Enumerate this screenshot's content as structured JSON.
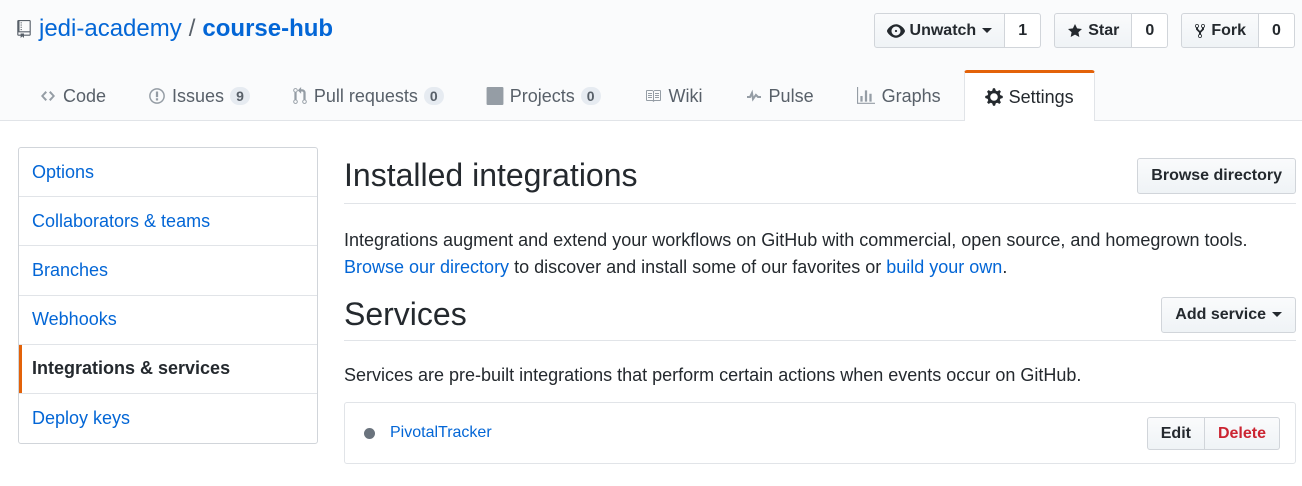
{
  "repo": {
    "owner": "jedi-academy",
    "separator": "/",
    "name": "course-hub"
  },
  "actions": [
    {
      "label": "Unwatch",
      "icon": "eye-icon",
      "count": "1",
      "dropdown": true
    },
    {
      "label": "Star",
      "icon": "star-icon",
      "count": "0"
    },
    {
      "label": "Fork",
      "icon": "fork-icon",
      "count": "0"
    }
  ],
  "tabs": [
    {
      "label": "Code",
      "icon": "code-icon"
    },
    {
      "label": "Issues",
      "icon": "issue-icon",
      "counter": "9"
    },
    {
      "label": "Pull requests",
      "icon": "pull-request-icon",
      "counter": "0"
    },
    {
      "label": "Projects",
      "icon": "project-icon",
      "counter": "0"
    },
    {
      "label": "Wiki",
      "icon": "book-icon"
    },
    {
      "label": "Pulse",
      "icon": "pulse-icon"
    },
    {
      "label": "Graphs",
      "icon": "graph-icon"
    },
    {
      "label": "Settings",
      "icon": "gear-icon",
      "selected": true
    }
  ],
  "sidebar": {
    "items": [
      {
        "label": "Options"
      },
      {
        "label": "Collaborators & teams"
      },
      {
        "label": "Branches"
      },
      {
        "label": "Webhooks"
      },
      {
        "label": "Integrations & services",
        "selected": true
      },
      {
        "label": "Deploy keys"
      }
    ]
  },
  "integrations": {
    "title": "Installed integrations",
    "browse_button": "Browse directory",
    "desc_text1": "Integrations augment and extend your workflows on GitHub with commercial, open source, and homegrown tools.",
    "desc_link1": "Browse our directory",
    "desc_text2": " to discover and install some of our favorites or ",
    "desc_link2": "build your own",
    "desc_text3": "."
  },
  "services": {
    "title": "Services",
    "add_button": "Add service",
    "description": "Services are pre-built integrations that perform certain actions when events occur on GitHub.",
    "items": [
      {
        "name": "PivotalTracker",
        "status_color": "#6a737d",
        "edit_label": "Edit",
        "delete_label": "Delete"
      }
    ]
  },
  "colors": {
    "accent": "#e36209",
    "link": "#0366d6",
    "danger": "#cb2431"
  }
}
